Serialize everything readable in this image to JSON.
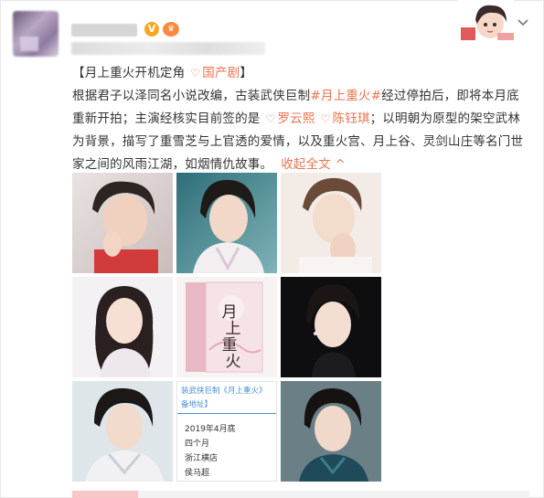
{
  "post": {
    "verified_badge": "V",
    "level_badge": "♛",
    "line1_prefix": "【月上重火开机定角",
    "tag1": "国产剧",
    "line1_suffix": "】",
    "body_a": "根据君子以泽同名小说改编，古装武侠巨制",
    "hashtag": "#月上重火#",
    "body_b": "经过停拍后，即将本月底重新开拍；主演经核实目前签的是",
    "actor1": "罗云熙",
    "actor2": "陈钰琪",
    "body_c": "；以明朝为原型的架空武林为背景，描写了重雪芝与上官透的爱情，以及重火宫、月上谷、灵剑山庄等名门世家之间的风雨江湖，如烟情仇故事。",
    "expand_label": "收起全文",
    "expand_arrow": "^",
    "tag_icon": "♡"
  },
  "images": {
    "book_cover_title": "月上重火",
    "info_card": {
      "header_line1": "装武侠巨制《月上重火》",
      "header_line2": "备地址】",
      "lines": [
        "2019年4月底",
        "四个月",
        "浙江横店",
        "侯马超"
      ]
    }
  },
  "colors": {
    "accent": "#eb7350",
    "text": "#333333",
    "info_blue": "#4a8fd6"
  },
  "icons": {
    "tag": "heart-tag-icon",
    "verified": "verified-v-icon",
    "level": "level-crown-icon",
    "more": "chevron-down-icon"
  }
}
